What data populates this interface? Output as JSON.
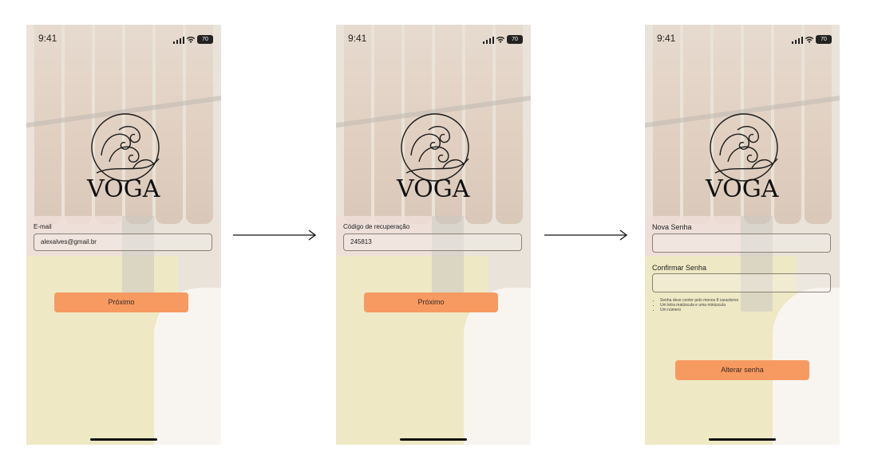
{
  "status_bar": {
    "time": "9:41",
    "battery": "70"
  },
  "brand": {
    "logo_text": "VOGA"
  },
  "screen1": {
    "email_label": "E-mail",
    "email_value": "alexalves@gmail.br",
    "next_label": "Próximo"
  },
  "screen2": {
    "code_label": "Código de recuperação",
    "code_value": "245813",
    "next_label": "Próximo"
  },
  "screen3": {
    "new_password_label": "Nova Senha",
    "new_password_value": "",
    "confirm_password_label": "Confirmar Senha",
    "confirm_password_value": "",
    "password_rules": [
      "Senha deve conter pelo menos 8 caracteres",
      "Um letra maiúscula e uma minúscula",
      "Um número"
    ],
    "change_password_label": "Alterar senha"
  },
  "colors": {
    "accent": "#f79a62",
    "text": "#222222"
  }
}
